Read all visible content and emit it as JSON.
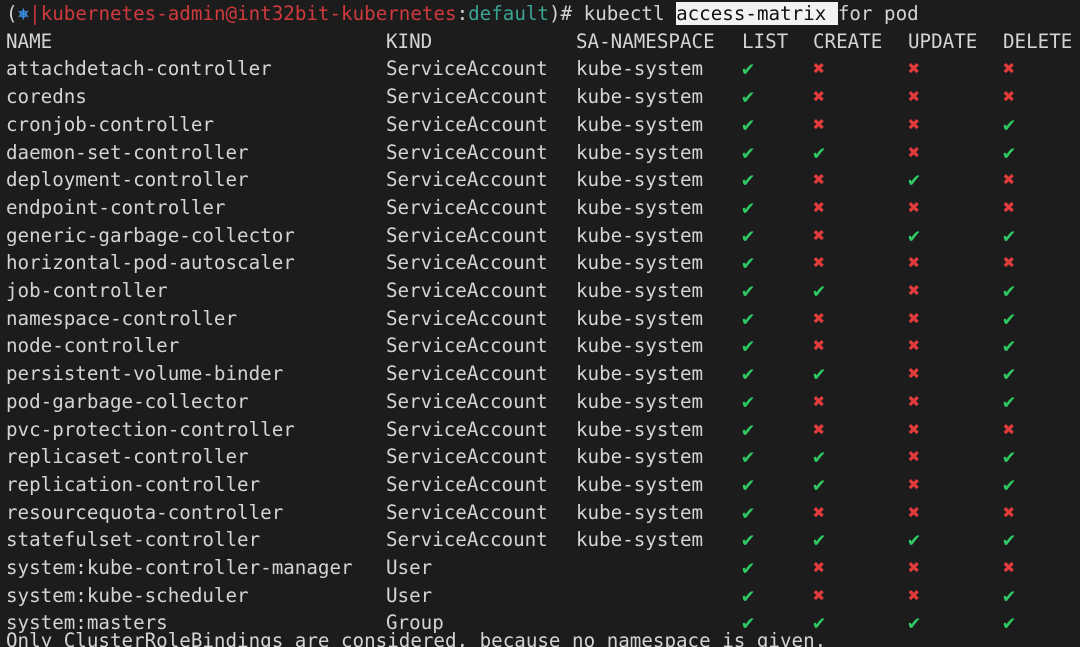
{
  "prompt": {
    "open_paren": "(",
    "icon": "⎈",
    "separator": "|",
    "context": "kubernetes-admin@int32bit-kubernetes",
    "colon": ":",
    "namespace": "default",
    "suffix": ")# kubectl ",
    "command_highlight": "access-matrix ",
    "command_rest": "for pod"
  },
  "colors": {
    "background": "#1c1c1c",
    "text": "#d4d4d4",
    "context_red": "#d0393d",
    "namespace_teal": "#3aa394",
    "icon_blue": "#3b8fe0",
    "allowed_green": "#2fc862",
    "denied_red": "#e23b3b"
  },
  "glyphs": {
    "allowed": "✔",
    "denied": "✖"
  },
  "table": {
    "headers": [
      "NAME",
      "KIND",
      "SA-NAMESPACE",
      "LIST",
      "CREATE",
      "UPDATE",
      "DELETE"
    ],
    "rows": [
      {
        "name": "attachdetach-controller",
        "kind": "ServiceAccount",
        "sa_namespace": "kube-system",
        "list": true,
        "create": false,
        "update": false,
        "delete": false
      },
      {
        "name": "coredns",
        "kind": "ServiceAccount",
        "sa_namespace": "kube-system",
        "list": true,
        "create": false,
        "update": false,
        "delete": false
      },
      {
        "name": "cronjob-controller",
        "kind": "ServiceAccount",
        "sa_namespace": "kube-system",
        "list": true,
        "create": false,
        "update": false,
        "delete": true
      },
      {
        "name": "daemon-set-controller",
        "kind": "ServiceAccount",
        "sa_namespace": "kube-system",
        "list": true,
        "create": true,
        "update": false,
        "delete": true
      },
      {
        "name": "deployment-controller",
        "kind": "ServiceAccount",
        "sa_namespace": "kube-system",
        "list": true,
        "create": false,
        "update": true,
        "delete": false
      },
      {
        "name": "endpoint-controller",
        "kind": "ServiceAccount",
        "sa_namespace": "kube-system",
        "list": true,
        "create": false,
        "update": false,
        "delete": false
      },
      {
        "name": "generic-garbage-collector",
        "kind": "ServiceAccount",
        "sa_namespace": "kube-system",
        "list": true,
        "create": false,
        "update": true,
        "delete": true
      },
      {
        "name": "horizontal-pod-autoscaler",
        "kind": "ServiceAccount",
        "sa_namespace": "kube-system",
        "list": true,
        "create": false,
        "update": false,
        "delete": false
      },
      {
        "name": "job-controller",
        "kind": "ServiceAccount",
        "sa_namespace": "kube-system",
        "list": true,
        "create": true,
        "update": false,
        "delete": true
      },
      {
        "name": "namespace-controller",
        "kind": "ServiceAccount",
        "sa_namespace": "kube-system",
        "list": true,
        "create": false,
        "update": false,
        "delete": true
      },
      {
        "name": "node-controller",
        "kind": "ServiceAccount",
        "sa_namespace": "kube-system",
        "list": true,
        "create": false,
        "update": false,
        "delete": true
      },
      {
        "name": "persistent-volume-binder",
        "kind": "ServiceAccount",
        "sa_namespace": "kube-system",
        "list": true,
        "create": true,
        "update": false,
        "delete": true
      },
      {
        "name": "pod-garbage-collector",
        "kind": "ServiceAccount",
        "sa_namespace": "kube-system",
        "list": true,
        "create": false,
        "update": false,
        "delete": true
      },
      {
        "name": "pvc-protection-controller",
        "kind": "ServiceAccount",
        "sa_namespace": "kube-system",
        "list": true,
        "create": false,
        "update": false,
        "delete": false
      },
      {
        "name": "replicaset-controller",
        "kind": "ServiceAccount",
        "sa_namespace": "kube-system",
        "list": true,
        "create": true,
        "update": false,
        "delete": true
      },
      {
        "name": "replication-controller",
        "kind": "ServiceAccount",
        "sa_namespace": "kube-system",
        "list": true,
        "create": true,
        "update": false,
        "delete": true
      },
      {
        "name": "resourcequota-controller",
        "kind": "ServiceAccount",
        "sa_namespace": "kube-system",
        "list": true,
        "create": false,
        "update": false,
        "delete": false
      },
      {
        "name": "statefulset-controller",
        "kind": "ServiceAccount",
        "sa_namespace": "kube-system",
        "list": true,
        "create": true,
        "update": true,
        "delete": true
      },
      {
        "name": "system:kube-controller-manager",
        "kind": "User",
        "sa_namespace": "",
        "list": true,
        "create": false,
        "update": false,
        "delete": false
      },
      {
        "name": "system:kube-scheduler",
        "kind": "User",
        "sa_namespace": "",
        "list": true,
        "create": false,
        "update": false,
        "delete": true
      },
      {
        "name": "system:masters",
        "kind": "Group",
        "sa_namespace": "",
        "list": true,
        "create": true,
        "update": true,
        "delete": true
      }
    ]
  },
  "footer": "Only ClusterRoleBindings are considered, because no namespace is given."
}
